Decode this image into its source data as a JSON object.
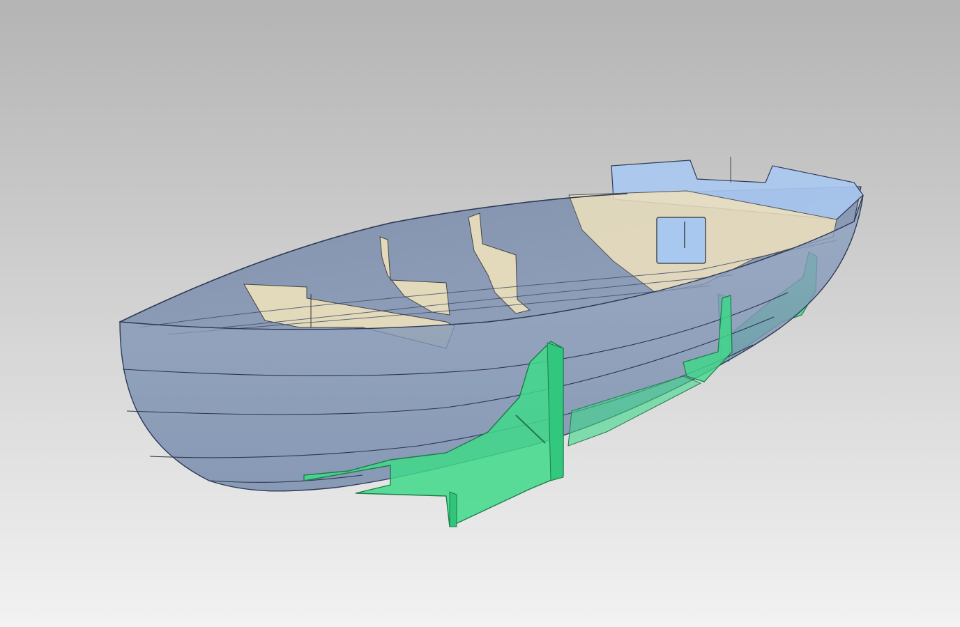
{
  "viewport": {
    "background_top": "#b4b4b4",
    "background_bottom": "#f2f2f2"
  },
  "model": {
    "hull_color": "#7f93b4",
    "hull_outline": "#2e3b55",
    "frame_color": "#efe2bd",
    "deck_color": "#a9c8ef",
    "cradle_color": "#3fd98a",
    "cradle_dark": "#2a9a60"
  }
}
